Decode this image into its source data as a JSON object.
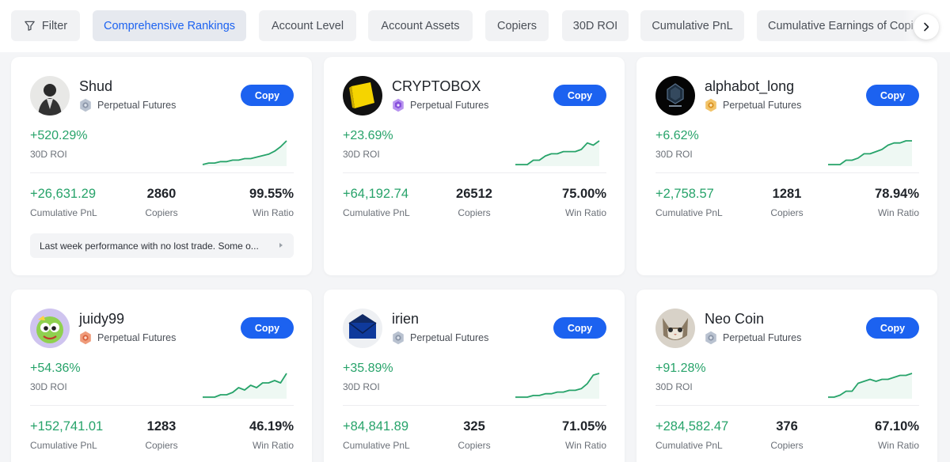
{
  "filters": {
    "filter_label": "Filter",
    "chips": [
      "Comprehensive Rankings",
      "Account Level",
      "Account Assets",
      "Copiers",
      "30D ROI",
      "Cumulative PnL",
      "Cumulative Earnings of Copiers"
    ],
    "active": "Comprehensive Rankings"
  },
  "labels": {
    "copy": "Copy",
    "roi": "30D ROI",
    "pnl": "Cumulative PnL",
    "copiers": "Copiers",
    "win": "Win Ratio"
  },
  "colors": {
    "accent": "#1c62f0",
    "positive": "#27a36a"
  },
  "traders": [
    {
      "name": "Shud",
      "product": "Perpetual Futures",
      "badge": "silver",
      "roi": "+520.29%",
      "pnl": "+26,631.29",
      "copiers": "2860",
      "win_ratio": "99.55%",
      "note": "Last week performance with no lost trade. Some o...",
      "sparkline": [
        2,
        3,
        3,
        4,
        4,
        5,
        5,
        6,
        6,
        7,
        8,
        9,
        11,
        14,
        18
      ]
    },
    {
      "name": "CRYPTOBOX",
      "product": "Perpetual Futures",
      "badge": "purple",
      "roi": "+23.69%",
      "pnl": "+64,192.74",
      "copiers": "26512",
      "win_ratio": "75.00%",
      "sparkline": [
        3,
        3,
        3,
        5,
        5,
        7,
        8,
        8,
        9,
        9,
        9,
        10,
        13,
        12,
        14
      ]
    },
    {
      "name": "alphabot_long",
      "product": "Perpetual Futures",
      "badge": "gold",
      "roi": "+6.62%",
      "pnl": "+2,758.57",
      "copiers": "1281",
      "win_ratio": "78.94%",
      "sparkline": [
        3,
        3,
        3,
        5,
        5,
        6,
        8,
        8,
        9,
        10,
        12,
        13,
        13,
        14,
        14
      ]
    },
    {
      "name": "juidy99",
      "product": "Perpetual Futures",
      "badge": "bronze",
      "roi": "+54.36%",
      "pnl": "+152,741.01",
      "copiers": "1283",
      "win_ratio": "46.19%",
      "sparkline": [
        2,
        2,
        2,
        3,
        3,
        4,
        6,
        5,
        7,
        6,
        8,
        8,
        9,
        8,
        12
      ]
    },
    {
      "name": "irien",
      "product": "Perpetual Futures",
      "badge": "silver",
      "roi": "+35.89%",
      "pnl": "+84,841.89",
      "copiers": "325",
      "win_ratio": "71.05%",
      "sparkline": [
        2,
        2,
        2,
        3,
        3,
        4,
        4,
        5,
        5,
        6,
        6,
        7,
        10,
        15,
        16
      ]
    },
    {
      "name": "Neo Coin",
      "product": "Perpetual Futures",
      "badge": "silver",
      "roi": "+91.28%",
      "pnl": "+284,582.47",
      "copiers": "376",
      "win_ratio": "67.10%",
      "sparkline": [
        2,
        2,
        3,
        5,
        5,
        9,
        10,
        11,
        10,
        11,
        11,
        12,
        13,
        13,
        14
      ]
    }
  ]
}
